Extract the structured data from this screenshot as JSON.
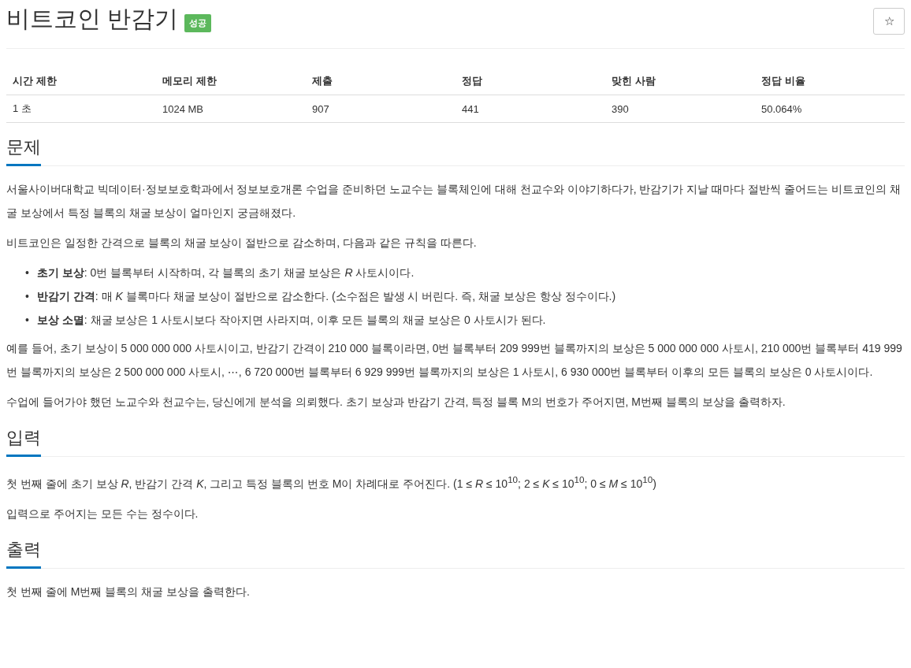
{
  "title": "비트코인 반감기",
  "badge": "성공",
  "star_button": "☆",
  "stats": {
    "columns": [
      "시간 제한",
      "메모리 제한",
      "제출",
      "정답",
      "맞힌 사람",
      "정답 비율"
    ],
    "row": [
      "1 초",
      "1024 MB",
      "907",
      "441",
      "390",
      "50.064%"
    ]
  },
  "sections": [
    {
      "heading": "문제",
      "blocks": [
        {
          "kind": "paragraph",
          "text": "서울사이버대학교 빅데이터·정보보호학과에서 정보보호개론 수업을 준비하던 노교수는 블록체인에 대해 천교수와 이야기하다가, 반감기가 지날 때마다 절반씩 줄어드는 비트코인의 채굴 보상에서 특정 블록의 채굴 보상이 얼마인지 궁금해졌다."
        },
        {
          "kind": "paragraph",
          "text": "비트코인은 일정한 간격으로 블록의 채굴 보상이 절반으로 감소하며, 다음과 같은 규칙을 따른다."
        },
        {
          "kind": "list",
          "items": [
            {
              "marker": "•",
              "text": "**초기 보상**: 0번 블록부터 시작하며, 각 블록의 초기 채굴 보상은 *R* 사토시이다."
            },
            {
              "marker": "•",
              "text": "**반감기 간격**: 매 *K* 블록마다 채굴 보상이 절반으로 감소한다. (소수점은 발생 시 버린다. 즉, 채굴 보상은 항상 정수이다.)"
            },
            {
              "marker": "•",
              "text": "**보상 소멸**: 채굴 보상은 1 사토시보다 작아지면 사라지며, 이후 모든 블록의 채굴 보상은 0 사토시가 된다."
            }
          ]
        },
        {
          "kind": "paragraph",
          "text": "예를 들어, 초기 보상이 5 000 000 000 사토시이고, 반감기 간격이 210 000 블록이라면, 0번 블록부터 209 999번 블록까지의 보상은 5 000 000 000 사토시, 210 000번 블록부터 419 999번 블록까지의 보상은 2 500 000 000 사토시, ⋯, 6 720 000번 블록부터 6 929 999번 블록까지의 보상은 1 사토시, 6 930 000번 블록부터 이후의 모든 블록의 보상은 0 사토시이다."
        },
        {
          "kind": "paragraph",
          "text": "수업에 들어가야 했던 노교수와 천교수는, 당신에게 분석을 의뢰했다. 초기 보상과 반감기 간격, 특정 블록 M의 번호가 주어지면, M번째 블록의 보상을 출력하자."
        }
      ]
    },
    {
      "heading": "입력",
      "blocks": [
        {
          "kind": "paragraph",
          "text": "첫 번째 줄에 초기 보상 *R*, 반감기 간격 *K*, 그리고 특정 블록의 번호 M이 차례대로 주어진다. (1 ≤ *R* ≤ 10$^{10}$; 2 ≤ *K* ≤ 10$^{10}$; 0 ≤ *M* ≤ 10$^{10}$)"
        },
        {
          "kind": "paragraph",
          "text": "입력으로 주어지는 모든 수는 정수이다."
        }
      ]
    },
    {
      "heading": "출력",
      "blocks": [
        {
          "kind": "paragraph",
          "text": "첫 번째 줄에 M번째 블록의 채굴 보상을 출력한다."
        }
      ]
    }
  ]
}
